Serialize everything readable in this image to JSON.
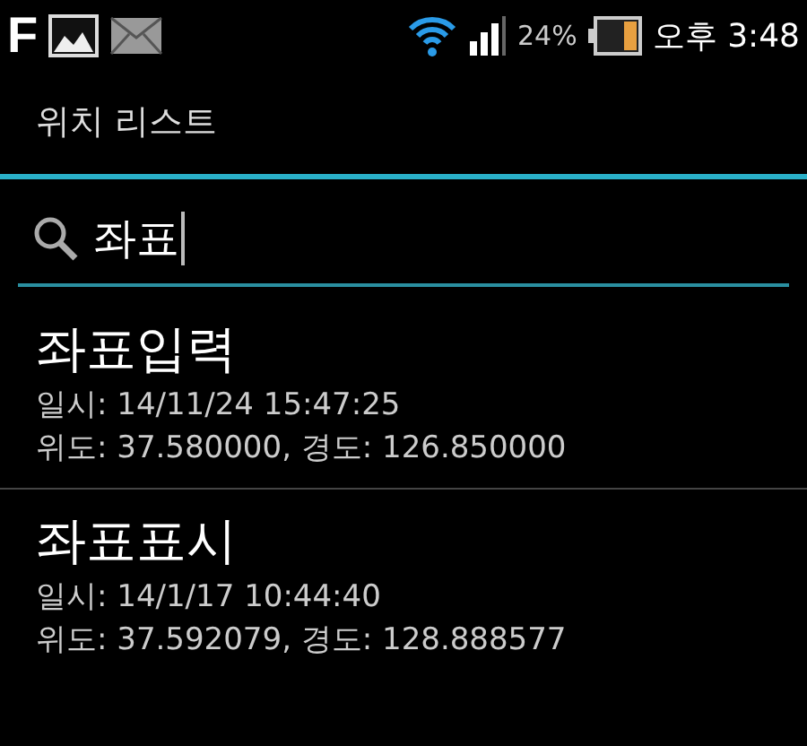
{
  "status_bar": {
    "notification_letter": "F",
    "battery_percent": "24%",
    "time": "오후 3:48"
  },
  "title_bar": {
    "title": "위치 리스트"
  },
  "search": {
    "value": "좌표"
  },
  "locations": [
    {
      "name": "좌표입력",
      "datetime": "일시: 14/11/24 15:47:25",
      "coords": "위도: 37.580000, 경도: 126.850000"
    },
    {
      "name": "좌표표시",
      "datetime": "일시: 14/1/17 10:44:40",
      "coords": "위도: 37.592079, 경도: 128.888577"
    }
  ]
}
